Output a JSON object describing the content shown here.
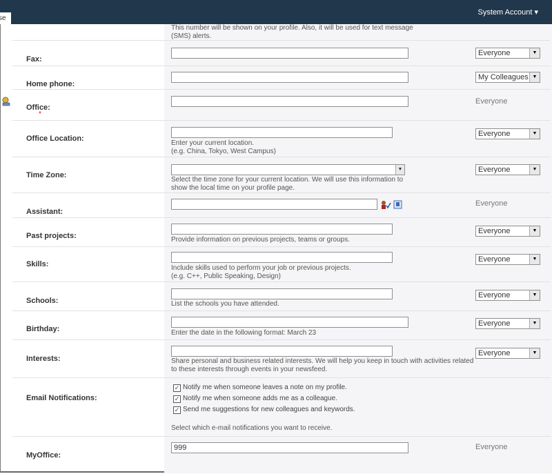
{
  "topbar": {
    "tab_label": "se",
    "account_label": "System Account ▾"
  },
  "mobile_desc": [
    "This number will be shown on your profile. Also, it will be used for text message",
    "(SMS) alerts."
  ],
  "rows": {
    "fax": {
      "label": "Fax:",
      "privacy": "Everyone"
    },
    "home_phone": {
      "label": "Home phone:",
      "privacy": "My Colleagues"
    },
    "office": {
      "label": "Office:",
      "privacy": "Everyone"
    },
    "office_location": {
      "label": "Office Location:",
      "desc": [
        "Enter your current location.",
        "(e.g. China, Tokyo, West Campus)"
      ],
      "privacy": "Everyone"
    },
    "time_zone": {
      "label": "Time Zone:",
      "desc": [
        "Select the time zone for your current location. We will use this information to",
        "show the local time on your profile page."
      ],
      "privacy": "Everyone"
    },
    "assistant": {
      "label": "Assistant:",
      "privacy": "Everyone"
    },
    "past_projects": {
      "label": "Past projects:",
      "desc": [
        "Provide information on previous projects, teams or groups."
      ],
      "privacy": "Everyone"
    },
    "skills": {
      "label": "Skills:",
      "desc": [
        "Include skills used to perform your job or previous projects.",
        "(e.g. C++, Public Speaking, Design)"
      ],
      "privacy": "Everyone"
    },
    "schools": {
      "label": "Schools:",
      "desc": [
        "List the schools you have attended."
      ],
      "privacy": "Everyone"
    },
    "birthday": {
      "label": "Birthday:",
      "desc": [
        "Enter the date in the following format: March 23"
      ],
      "privacy": "Everyone"
    },
    "interests": {
      "label": "Interests:",
      "desc": [
        "Share personal and business related interests. We will help you keep in touch with activities related",
        "to these interests through events in your newsfeed."
      ],
      "privacy": "Everyone"
    },
    "email_notifications": {
      "label": "Email Notifications:",
      "options": [
        "Notify me when someone leaves a note on my profile.",
        "Notify me when someone adds me as a colleague.",
        "Send me suggestions for new colleagues and keywords."
      ],
      "desc": "Select which e-mail notifications you want to receive."
    },
    "myoffice": {
      "label": "MyOffice:",
      "value": "999",
      "privacy": "Everyone"
    }
  },
  "icons": {
    "office_row": "user-info-icon",
    "people_picker": "check-names-icon",
    "browse": "address-book-icon",
    "required": "asterisk"
  }
}
